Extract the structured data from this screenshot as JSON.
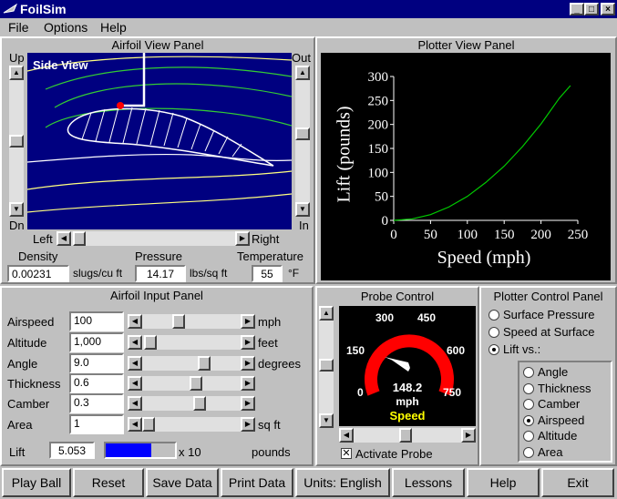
{
  "window": {
    "title": "FoilSim"
  },
  "menu": [
    "File",
    "Options",
    "Help"
  ],
  "airfoil_view": {
    "title": "Airfoil View Panel",
    "side_view": "Side View",
    "up": "Up",
    "dn": "Dn",
    "out": "Out",
    "in": "In",
    "left": "Left",
    "right": "Right"
  },
  "conditions": {
    "density_label": "Density",
    "density_value": "0.00231",
    "density_unit": "slugs/cu ft",
    "pressure_label": "Pressure",
    "pressure_value": "14.17",
    "pressure_unit": "lbs/sq ft",
    "temp_label": "Temperature",
    "temp_value": "55",
    "temp_unit": "°F"
  },
  "plotter_view": {
    "title": "Plotter View Panel"
  },
  "chart_data": {
    "type": "line",
    "xlabel": "Speed (mph)",
    "ylabel": "Lift (pounds)",
    "xlim": [
      0,
      250
    ],
    "ylim": [
      0,
      300
    ],
    "xticks": [
      "0",
      "50",
      "100",
      "150",
      "200",
      "250"
    ],
    "yticks": [
      "0",
      "50",
      "100",
      "150",
      "200",
      "250",
      "300"
    ],
    "series": [
      {
        "x": [
          0,
          25,
          50,
          75,
          100,
          125,
          150,
          175,
          200,
          225,
          240
        ],
        "y": [
          0,
          3,
          12,
          28,
          50,
          79,
          113,
          154,
          201,
          255,
          281
        ]
      }
    ],
    "line_color": "#00cc00"
  },
  "input_panel": {
    "title": "Airfoil Input Panel",
    "rows": [
      {
        "label": "Airspeed",
        "value": "100",
        "unit": "mph",
        "pos": 0.35
      },
      {
        "label": "Altitude",
        "value": "1,000",
        "unit": "feet",
        "pos": 0.02
      },
      {
        "label": "Angle",
        "value": "9.0",
        "unit": "degrees",
        "pos": 0.65
      },
      {
        "label": "Thickness",
        "value": "0.6",
        "unit": "",
        "pos": 0.55
      },
      {
        "label": "Camber",
        "value": "0.3",
        "unit": "",
        "pos": 0.6
      },
      {
        "label": "Area",
        "value": "1",
        "unit": "sq ft",
        "pos": 0.0
      }
    ],
    "lift_label": "Lift",
    "lift_value": "5.053",
    "lift_fill": 0.66,
    "lift_mult": "x 10",
    "lift_unit": "pounds"
  },
  "probe": {
    "title": "Probe Control",
    "gauge_labels": [
      "0",
      "150",
      "300",
      "450",
      "600",
      "750"
    ],
    "value": "148.2",
    "unit": "mph",
    "mode": "Speed",
    "activate_label": "Activate Probe",
    "activated": true
  },
  "plotter_control": {
    "title": "Plotter Control Panel",
    "options": [
      "Surface Pressure",
      "Speed at Surface",
      "Lift vs.:"
    ],
    "selected": "Lift vs.:",
    "lift_vs": [
      "Angle",
      "Thickness",
      "Camber",
      "Airspeed",
      "Altitude",
      "Area"
    ],
    "lift_vs_selected": "Airspeed"
  },
  "buttons": [
    "Play Ball",
    "Reset",
    "Save Data",
    "Print Data",
    "Units: English",
    "Lessons",
    "Help",
    "Exit"
  ],
  "colors": {
    "title_bar": "#000080",
    "sky": "#000080",
    "foil_line": "#ffffff",
    "stream": "#ffff80",
    "stream_near": "#33cc33",
    "probe_dot": "#ff0000",
    "gauge": "#ff0000",
    "speed_text": "#ffff00"
  }
}
